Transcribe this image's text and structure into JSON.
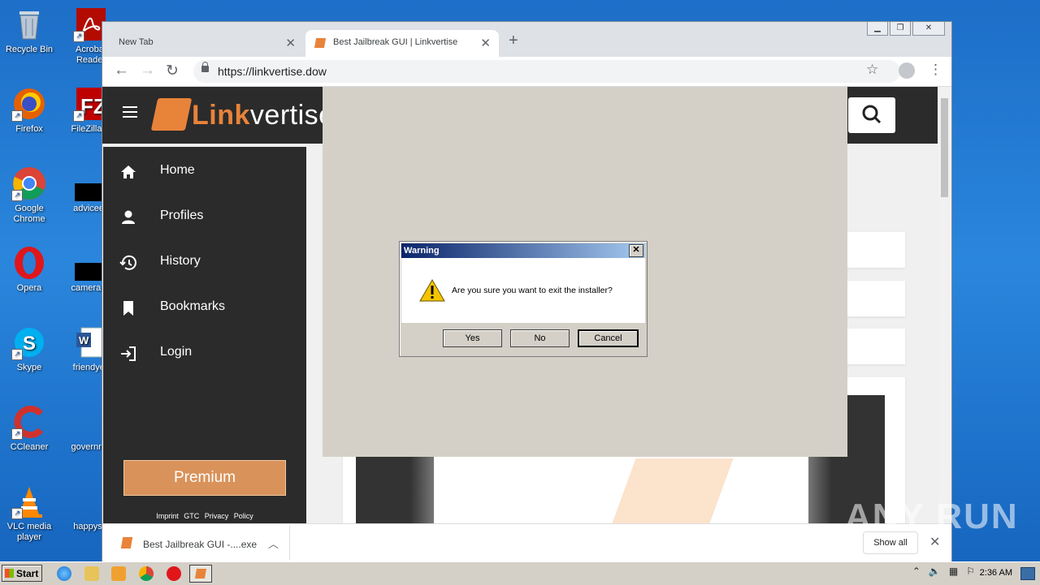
{
  "desktop": {
    "icons": [
      {
        "label": "Recycle Bin"
      },
      {
        "label": "Acrobat Reader"
      },
      {
        "label": "Firefox"
      },
      {
        "label": "FileZilla C"
      },
      {
        "label": "Google Chrome"
      },
      {
        "label": "adviceeff"
      },
      {
        "label": "Opera"
      },
      {
        "label": "camerapa"
      },
      {
        "label": "Skype"
      },
      {
        "label": "friendyes"
      },
      {
        "label": "CCleaner"
      },
      {
        "label": "governme"
      },
      {
        "label": "VLC media player"
      },
      {
        "label": "happysw"
      }
    ]
  },
  "browser": {
    "tabs": [
      {
        "title": "New Tab"
      },
      {
        "title": "Best Jailbreak GUI | Linkvertise"
      }
    ],
    "address": "https://linkvertise.dow"
  },
  "site": {
    "logo": {
      "prefix": "Link",
      "suffix": "vertise"
    },
    "nav": [
      {
        "label": "Home",
        "icon": "home-icon"
      },
      {
        "label": "Profiles",
        "icon": "person-icon"
      },
      {
        "label": "History",
        "icon": "history-icon"
      },
      {
        "label": "Bookmarks",
        "icon": "bookmark-icon"
      },
      {
        "label": "Login",
        "icon": "login-icon"
      }
    ],
    "premium_label": "Premium",
    "footer": [
      "Imprint",
      "GTC",
      "Privacy Policy"
    ],
    "accent": "#e8833a"
  },
  "dialog": {
    "title": "Warning",
    "message": "Are you sure you want to exit the installer?",
    "buttons": {
      "yes": "Yes",
      "no": "No",
      "cancel": "Cancel"
    }
  },
  "downloads": {
    "file_name": "Best Jailbreak GUI -....exe",
    "show_all": "Show all"
  },
  "taskbar": {
    "start_label": "Start",
    "clock": "2:36 AM"
  },
  "watermark": "ANY RUN"
}
